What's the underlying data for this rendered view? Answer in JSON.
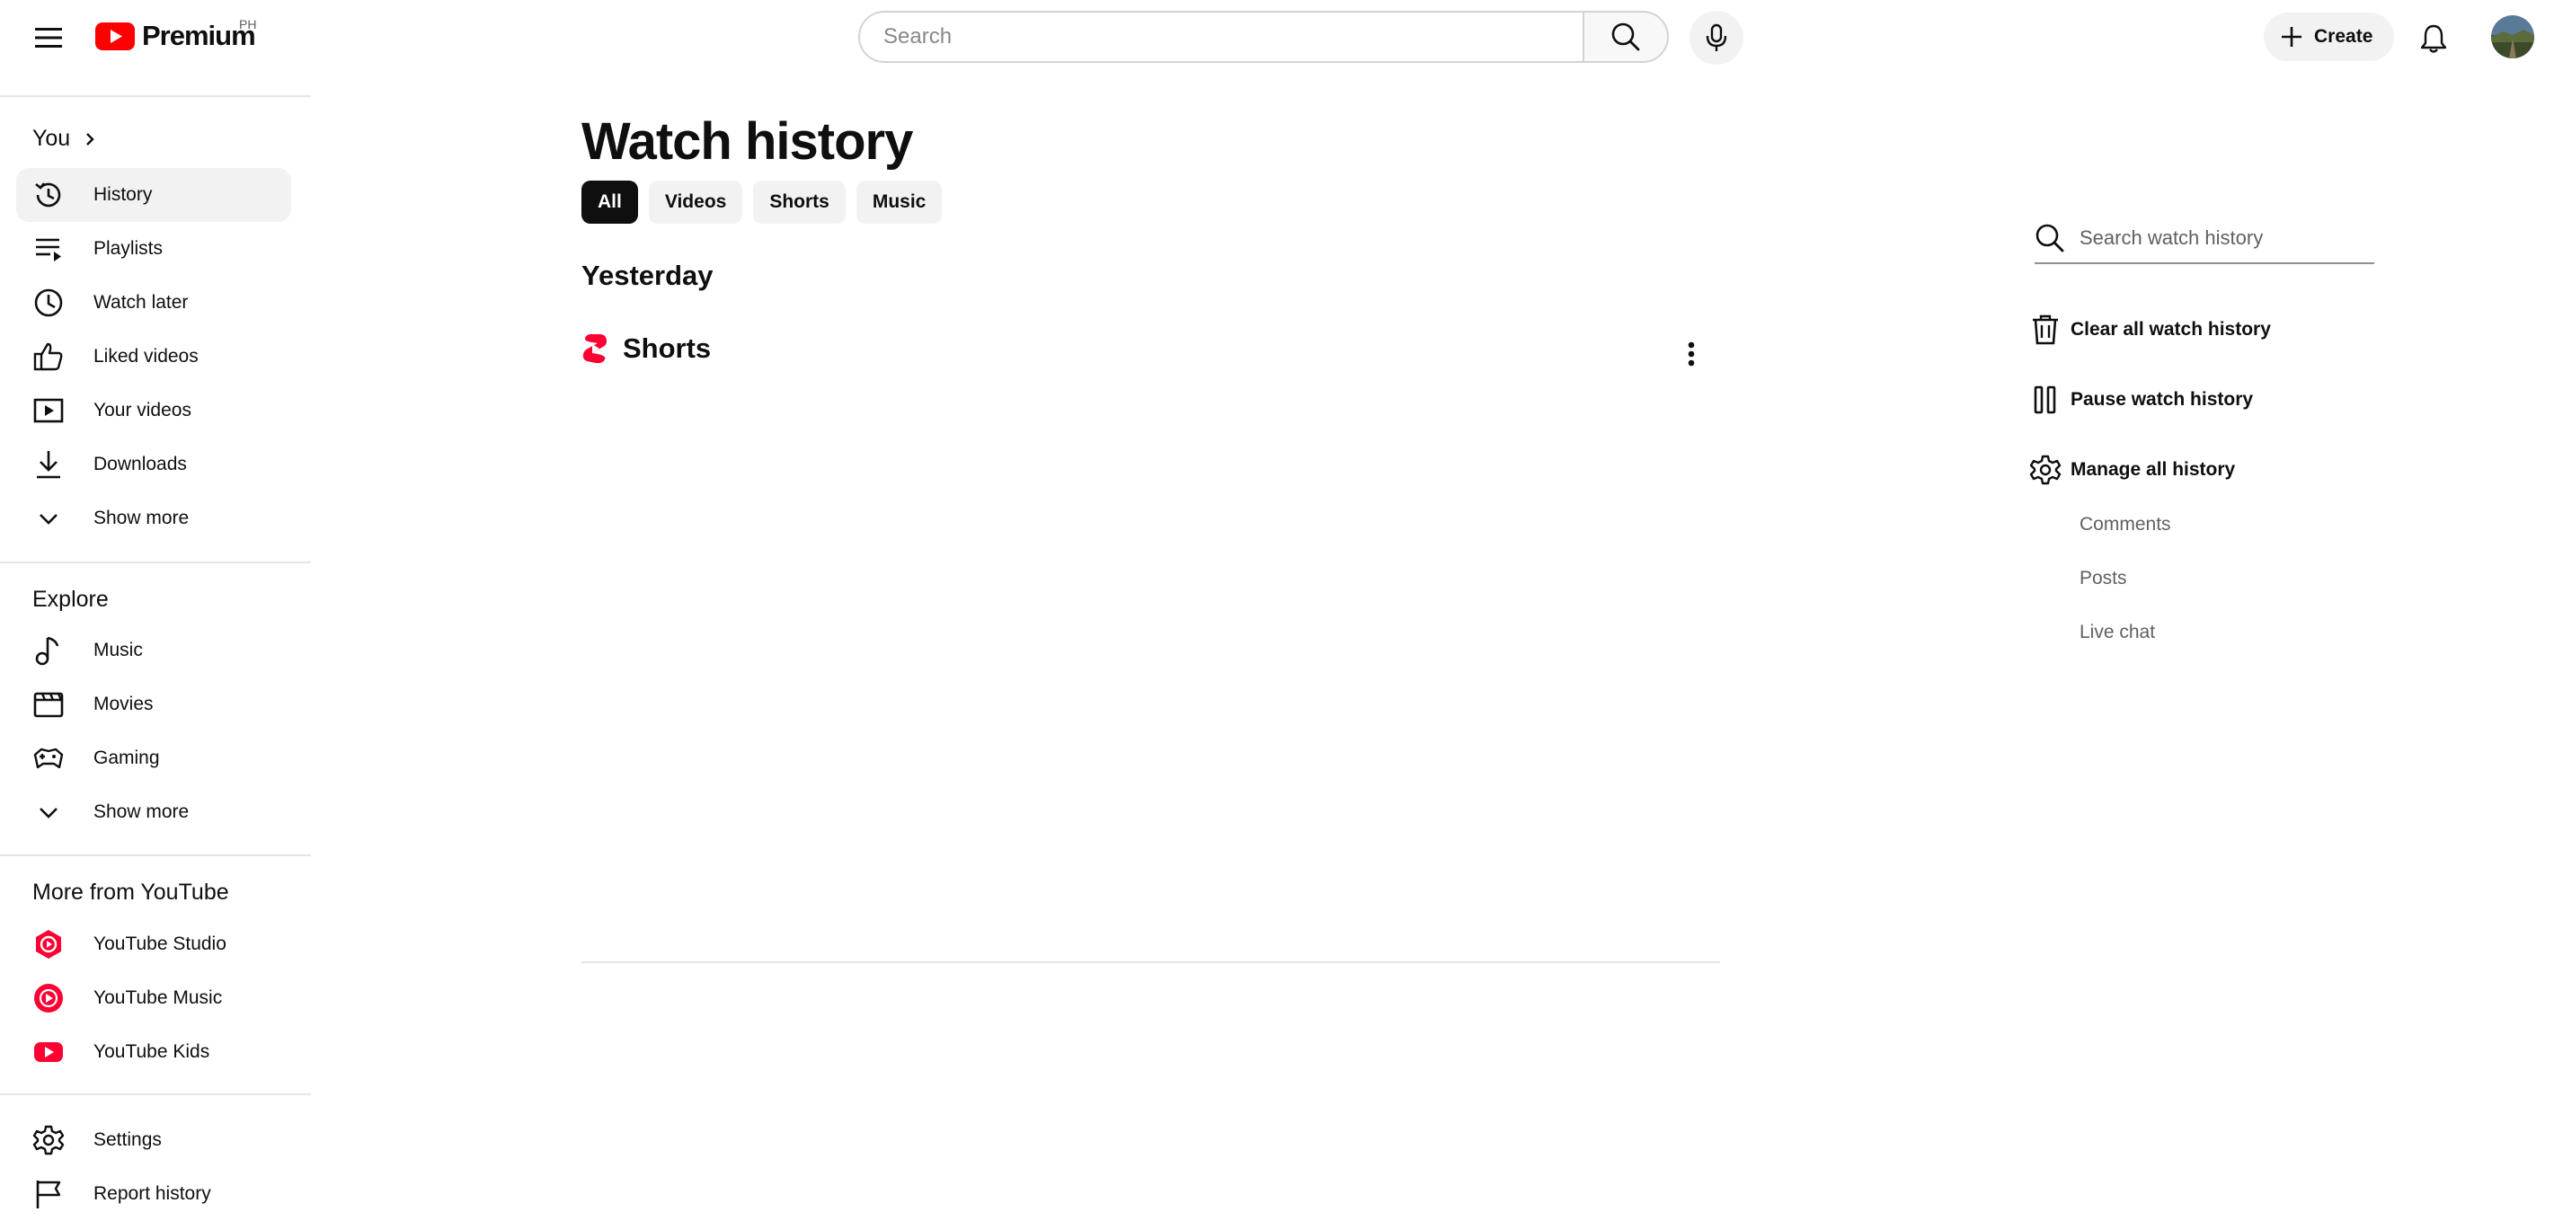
{
  "masthead": {
    "logo_text": "Premium",
    "country_code": "PH",
    "search_placeholder": "Search",
    "create_label": "Create"
  },
  "sidebar": {
    "you_label": "You",
    "you_items": [
      {
        "label": "History",
        "icon": "history-icon",
        "active": true
      },
      {
        "label": "Playlists",
        "icon": "playlists-icon"
      },
      {
        "label": "Watch later",
        "icon": "watch-later-icon"
      },
      {
        "label": "Liked videos",
        "icon": "thumbs-up-icon"
      },
      {
        "label": "Your videos",
        "icon": "your-videos-icon"
      },
      {
        "label": "Downloads",
        "icon": "download-icon"
      },
      {
        "label": "Show more",
        "icon": "chevron-down-icon"
      }
    ],
    "explore_label": "Explore",
    "explore_items": [
      {
        "label": "Music",
        "icon": "music-note-icon"
      },
      {
        "label": "Movies",
        "icon": "clapperboard-icon"
      },
      {
        "label": "Gaming",
        "icon": "gamepad-icon"
      },
      {
        "label": "Show more",
        "icon": "chevron-down-icon"
      }
    ],
    "more_label": "More from YouTube",
    "more_items": [
      {
        "label": "YouTube Studio",
        "icon": "youtube-studio-icon"
      },
      {
        "label": "YouTube Music",
        "icon": "youtube-music-icon"
      },
      {
        "label": "YouTube Kids",
        "icon": "youtube-kids-icon"
      }
    ],
    "footer_items": [
      {
        "label": "Settings",
        "icon": "gear-icon"
      },
      {
        "label": "Report history",
        "icon": "flag-icon"
      }
    ]
  },
  "main": {
    "title": "Watch history",
    "chips": [
      {
        "label": "All",
        "active": true
      },
      {
        "label": "Videos"
      },
      {
        "label": "Shorts"
      },
      {
        "label": "Music"
      }
    ],
    "date_heading": "Yesterday",
    "shelf_title": "Shorts"
  },
  "right_panel": {
    "search_placeholder": "Search watch history",
    "clear_label": "Clear all watch history",
    "pause_label": "Pause watch history",
    "manage_label": "Manage all history",
    "sub_links": [
      "Comments",
      "Posts",
      "Live chat"
    ]
  },
  "colors": {
    "brand_red": "#ff0000",
    "text_primary": "#0f0f0f",
    "text_secondary": "#606060",
    "chip_bg": "#f2f2f2"
  }
}
